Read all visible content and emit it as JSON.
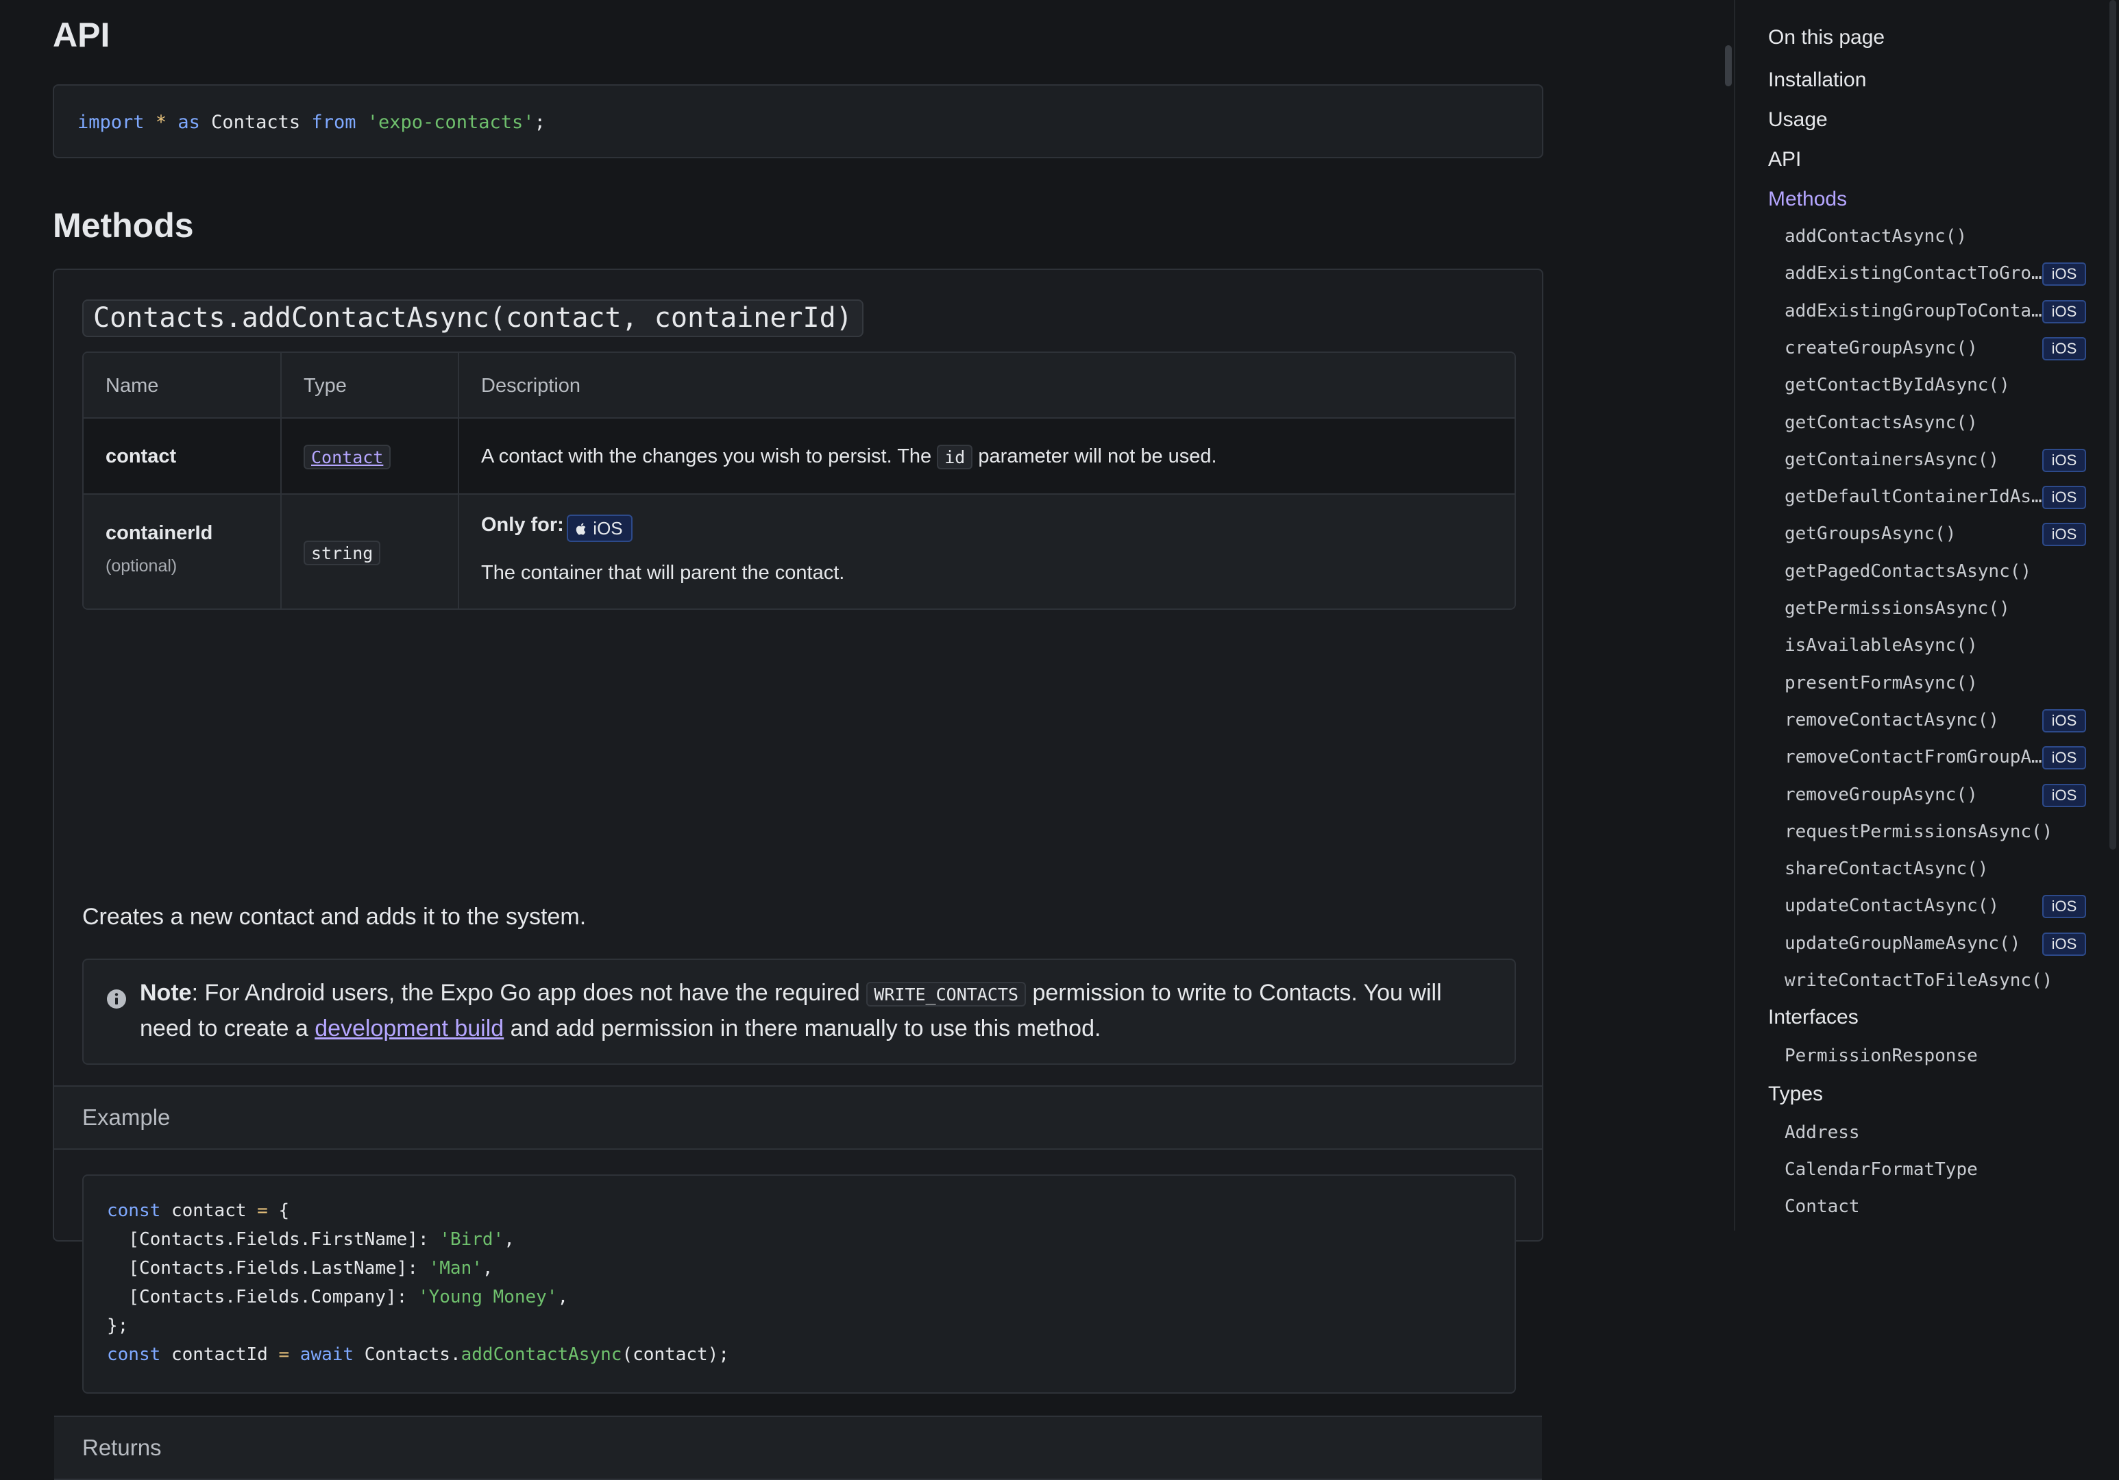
{
  "api_heading": "API",
  "import_code": {
    "kw_import": "import",
    "star": "*",
    "kw_as": "as",
    "name": "Contacts",
    "kw_from": "from",
    "module": "'expo-contacts'",
    "semi": ";"
  },
  "methods_heading": "Methods",
  "method": {
    "signature": "Contacts.addContactAsync(contact, containerId)",
    "table": {
      "headers": {
        "name": "Name",
        "type": "Type",
        "description": "Description"
      },
      "rows": [
        {
          "name": "contact",
          "type": "Contact",
          "desc_before": "A contact with the changes you wish to persist. The",
          "desc_code": "id",
          "desc_after": "parameter will not be used."
        },
        {
          "name": "containerId",
          "optional": "(optional)",
          "type": "string",
          "only_for": "Only for:",
          "platform": "iOS",
          "desc": "The container that will parent the contact."
        }
      ]
    },
    "description": "Creates a new contact and adds it to the system.",
    "note": {
      "label": "Note",
      "text_1": ": For Android users, the Expo Go app does not have the required",
      "code": "WRITE_CONTACTS",
      "text_2": "permission to write to Contacts. You will need to create a",
      "link": "development build",
      "text_3": "and add permission in there manually to use this method."
    },
    "example_label": "Example",
    "example_code": {
      "l1_kw": "const",
      "l1_id": "contact",
      "l1_eq": "=",
      "l1_br": "{",
      "l2_key": "[Contacts.Fields.FirstName]",
      "l2_val": "'Bird'",
      "l3_key": "[Contacts.Fields.LastName]",
      "l3_val": "'Man'",
      "l4_key": "[Contacts.Fields.Company]",
      "l4_val": "'Young Money'",
      "l5": "};",
      "l6_kw": "const",
      "l6_id": "contactId",
      "l6_eq": "=",
      "l6_await": "await",
      "l6_obj": "Contacts.",
      "l6_fn": "addContactAsync",
      "l6_args": "(contact);"
    },
    "returns_label": "Returns"
  },
  "sidebar": {
    "title": "On this page",
    "sections": [
      "Installation",
      "Usage",
      "API",
      "Methods"
    ],
    "active_section": "Methods",
    "method_items": [
      {
        "label": "addContactAsync()",
        "badge": ""
      },
      {
        "label": "addExistingContactToGro…",
        "badge": "iOS"
      },
      {
        "label": "addExistingGroupToConta…",
        "badge": "iOS"
      },
      {
        "label": "createGroupAsync()",
        "badge": "iOS"
      },
      {
        "label": "getContactByIdAsync()",
        "badge": ""
      },
      {
        "label": "getContactsAsync()",
        "badge": ""
      },
      {
        "label": "getContainersAsync()",
        "badge": "iOS"
      },
      {
        "label": "getDefaultContainerIdAs…",
        "badge": "iOS"
      },
      {
        "label": "getGroupsAsync()",
        "badge": "iOS"
      },
      {
        "label": "getPagedContactsAsync()",
        "badge": ""
      },
      {
        "label": "getPermissionsAsync()",
        "badge": ""
      },
      {
        "label": "isAvailableAsync()",
        "badge": ""
      },
      {
        "label": "presentFormAsync()",
        "badge": ""
      },
      {
        "label": "removeContactAsync()",
        "badge": "iOS"
      },
      {
        "label": "removeContactFromGroupA…",
        "badge": "iOS"
      },
      {
        "label": "removeGroupAsync()",
        "badge": "iOS"
      },
      {
        "label": "requestPermissionsAsync()",
        "badge": ""
      },
      {
        "label": "shareContactAsync()",
        "badge": ""
      },
      {
        "label": "updateContactAsync()",
        "badge": "iOS"
      },
      {
        "label": "updateGroupNameAsync()",
        "badge": "iOS"
      },
      {
        "label": "writeContactToFileAsync()",
        "badge": ""
      }
    ],
    "interfaces_label": "Interfaces",
    "interface_items": [
      "PermissionResponse"
    ],
    "types_label": "Types",
    "type_items": [
      "Address",
      "CalendarFormatType",
      "Contact"
    ]
  }
}
